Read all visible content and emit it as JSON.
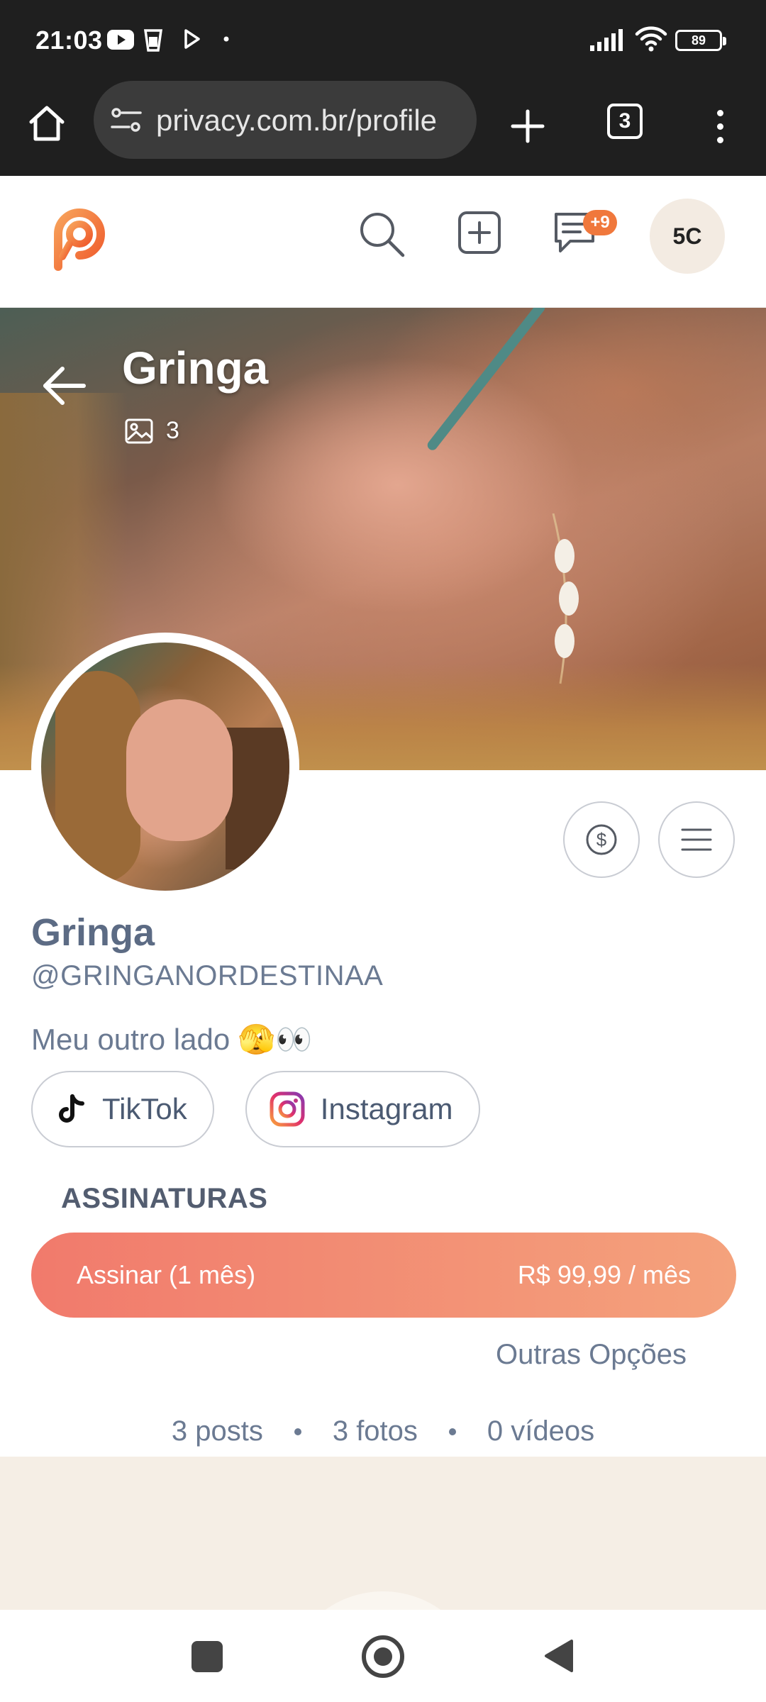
{
  "status_bar": {
    "time": "21:03",
    "battery": "89",
    "left_icons": [
      "youtube-icon",
      "cup-icon",
      "play-store-icon",
      "dot-icon"
    ],
    "right_icons": [
      "signal-icon",
      "wifi-icon",
      "battery-icon"
    ]
  },
  "browser": {
    "url": "privacy.com.br/profile",
    "tab_count": "3",
    "icons": [
      "home-icon",
      "site-settings-icon",
      "new-tab-icon",
      "tabs-icon",
      "more-vert-icon"
    ]
  },
  "header": {
    "icons": [
      "privacy-logo-icon",
      "search-icon",
      "add-post-icon",
      "chat-icon"
    ],
    "chat_badge": "+9",
    "avatar_initials": "5C",
    "accent_color": "#f0783c"
  },
  "cover": {
    "title": "Gringa",
    "media_count": "3"
  },
  "profile": {
    "name": "Gringa",
    "handle": "@GRINGANORDESTINAA",
    "bio": "Meu outro lado 🫣👀",
    "actions": [
      "tip-icon",
      "menu-icon"
    ],
    "socials": [
      {
        "label": "TikTok",
        "icon": "tiktok-icon"
      },
      {
        "label": "Instagram",
        "icon": "instagram-icon"
      }
    ]
  },
  "subscriptions": {
    "section_title": "ASSINATURAS",
    "subscribe_label": "Assinar (1 mês)",
    "subscribe_price": "R$ 99,99 / mês",
    "other_options": "Outras Opções",
    "gradient": [
      "#f17a6c",
      "#f4a27c"
    ]
  },
  "stats": {
    "posts": "3 posts",
    "photos": "3 fotos",
    "videos": "0 vídeos"
  },
  "nav": {
    "icons": [
      "recents-icon",
      "home-nav-icon",
      "back-nav-icon"
    ]
  }
}
